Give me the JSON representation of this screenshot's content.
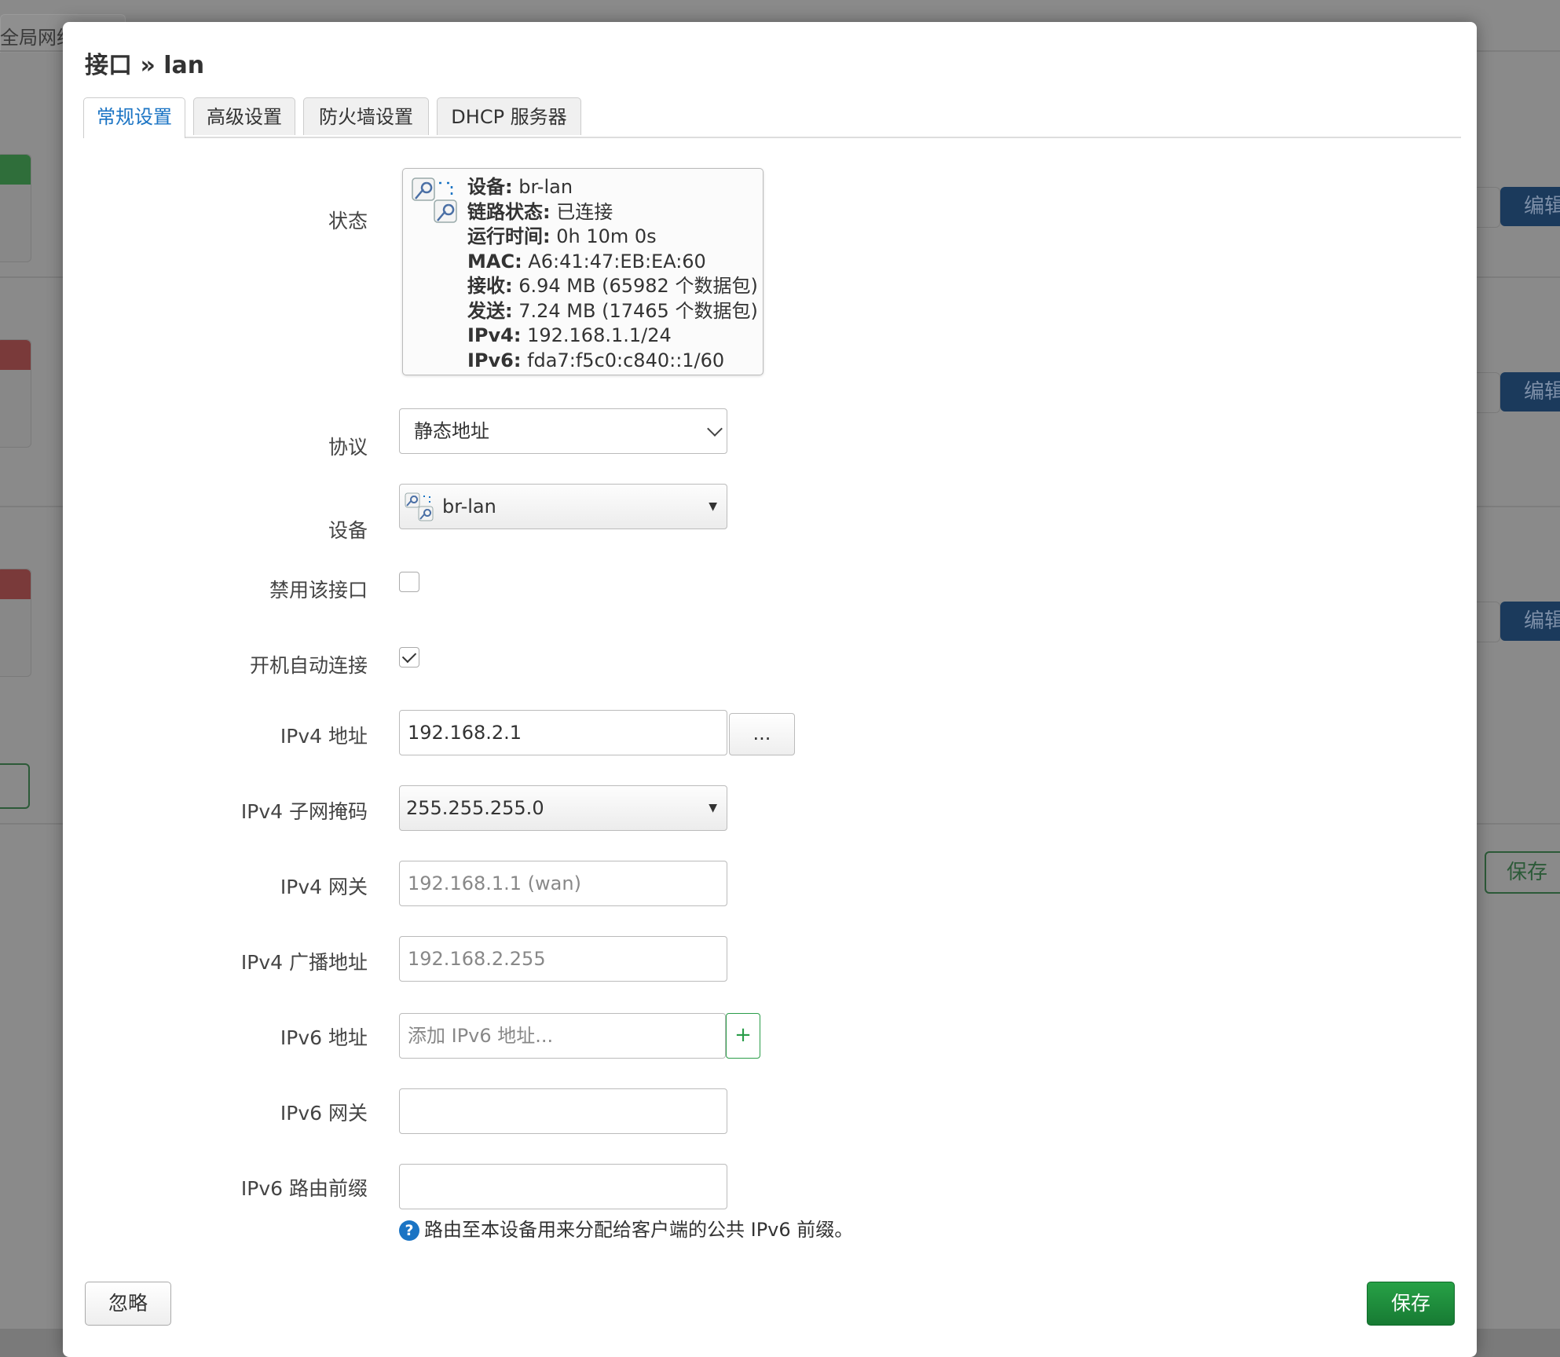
{
  "background": {
    "tab_label": "全局网络",
    "edit_label": "编辑",
    "save_label": "保存"
  },
  "modal": {
    "title": "接口 » lan",
    "tabs": [
      {
        "label": "常规设置",
        "active": true
      },
      {
        "label": "高级设置",
        "active": false
      },
      {
        "label": "防火墙设置",
        "active": false
      },
      {
        "label": "DHCP 服务器",
        "active": false
      }
    ]
  },
  "status": {
    "label": "状态",
    "lines": [
      {
        "key": "设备:",
        "value": " br-lan"
      },
      {
        "key": "链路状态:",
        "value": " 已连接"
      },
      {
        "key": "运行时间:",
        "value": " 0h 10m 0s"
      },
      {
        "key": "MAC:",
        "value": " A6:41:47:EB:EA:60"
      },
      {
        "key": "接收:",
        "value": " 6.94 MB (65982 个数据包)"
      },
      {
        "key": "发送:",
        "value": " 7.24 MB (17465 个数据包)"
      },
      {
        "key": "IPv4:",
        "value": " 192.168.1.1/24"
      },
      {
        "key": "IPv6:",
        "value": " fda7:f5c0:c840::1/60"
      }
    ]
  },
  "protocol": {
    "label": "协议",
    "value": "静态地址"
  },
  "device": {
    "label": "设备",
    "value": "br-lan",
    "icon": "network-bridge-icon"
  },
  "disable_iface": {
    "label": "禁用该接口",
    "checked": false
  },
  "autostart": {
    "label": "开机自动连接",
    "checked": true
  },
  "ipv4_addr": {
    "label": "IPv4 地址",
    "value": "192.168.2.1",
    "more_label": "..."
  },
  "ipv4_mask": {
    "label": "IPv4 子网掩码",
    "value": "255.255.255.0"
  },
  "ipv4_gw": {
    "label": "IPv4 网关",
    "placeholder": "192.168.1.1 (wan)"
  },
  "ipv4_bcast": {
    "label": "IPv4 广播地址",
    "placeholder": "192.168.2.255"
  },
  "ipv6_addr": {
    "label": "IPv6 地址",
    "placeholder": "添加 IPv6 地址...",
    "add_label": "+"
  },
  "ipv6_gw": {
    "label": "IPv6 网关",
    "value": ""
  },
  "ipv6_prefix": {
    "label": "IPv6 路由前缀",
    "value": "",
    "help": "路由至本设备用来分配给客户端的公共 IPv6 前缀。"
  },
  "footer": {
    "ignore_label": "忽略",
    "save_label": "保存"
  },
  "colors": {
    "accent": "#1b74c4",
    "save_green": "#1f8f3c",
    "add_green": "#2a9d49"
  }
}
